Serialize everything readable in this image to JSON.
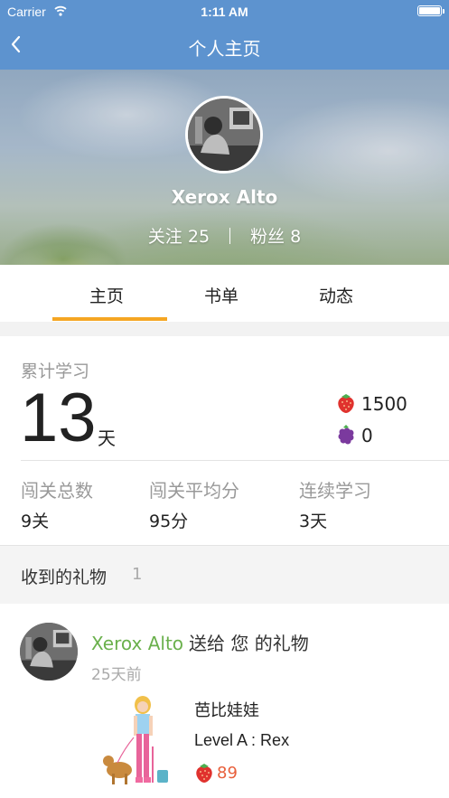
{
  "status_bar": {
    "carrier": "Carrier",
    "time": "1:11 AM"
  },
  "nav": {
    "title": "个人主页"
  },
  "profile": {
    "name": "Xerox Alto",
    "following_label": "关注",
    "following_count": "25",
    "followers_label": "粉丝",
    "followers_count": "8"
  },
  "tabs": [
    {
      "label": "主页",
      "active": true
    },
    {
      "label": "书单",
      "active": false
    },
    {
      "label": "动态",
      "active": false
    }
  ],
  "stats": {
    "cumulative_label": "累计学习",
    "days": "13",
    "days_unit": "天",
    "strawberries": "1500",
    "blackberries": "0",
    "columns": [
      {
        "label": "闯关总数",
        "value": "9关"
      },
      {
        "label": "闯关平均分",
        "value": "95分"
      },
      {
        "label": "连续学习",
        "value": "3天"
      }
    ]
  },
  "gifts": {
    "header": "收到的礼物",
    "count": "1",
    "items": [
      {
        "sender": "Xerox Alto",
        "message": "送给 您 的礼物",
        "time_ago": "25天前",
        "gift_name": "芭比娃娃",
        "level": "Level A : Rex",
        "price": "89"
      }
    ]
  },
  "colors": {
    "nav_bg": "#5d93cf",
    "tab_accent": "#f5a623",
    "sender_green": "#6ab04c",
    "price_orange": "#e8603c"
  }
}
